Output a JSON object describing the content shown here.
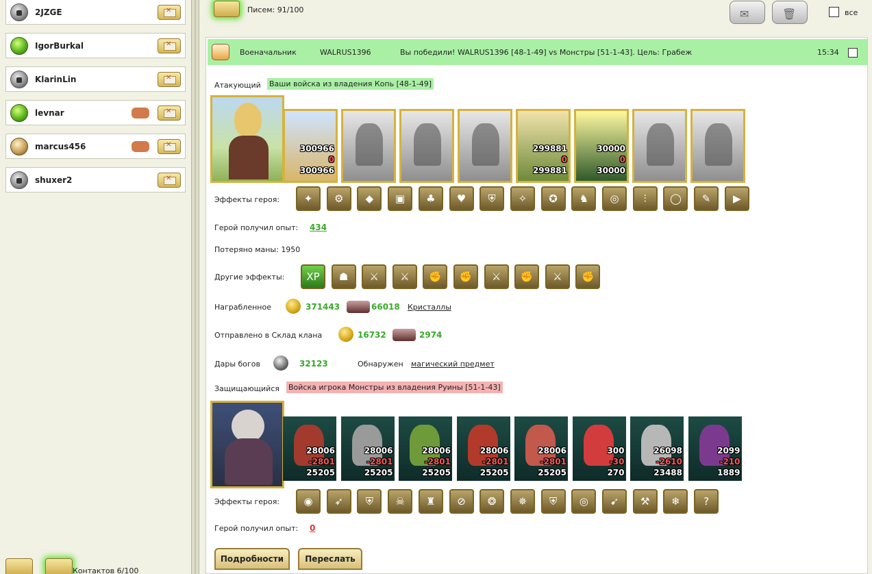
{
  "contacts": [
    {
      "name": "2JZGE",
      "avatar": "lock-icon",
      "has_shake": false
    },
    {
      "name": "IgorBurkal",
      "avatar": "green-gem-icon",
      "has_shake": false
    },
    {
      "name": "KlarinLin",
      "avatar": "lock-icon",
      "has_shake": false
    },
    {
      "name": "levnar",
      "avatar": "green-gem-icon",
      "has_shake": true
    },
    {
      "name": "marcus456",
      "avatar": "tan-gem-icon",
      "has_shake": true
    },
    {
      "name": "shuxer2",
      "avatar": "lock-icon",
      "has_shake": false
    }
  ],
  "contacts_count": "Контактов 6/100",
  "letters_count": "Писем: 91/100",
  "all_label": "все",
  "message": {
    "rank": "Военачальник",
    "player": "WALRUS1396",
    "summary": "Вы победили! WALRUS1396 [48-1-49] vs Монстры [51-1-43]. Цель: Грабеж",
    "time": "15:34"
  },
  "attacker": {
    "label": "Атакующий",
    "desc": "Ваши войска из владения Копь [48-1-49]",
    "units": [
      {
        "style": "col-a",
        "n1": "300966",
        "n2": "0",
        "n3": "300966"
      },
      {
        "style": "gray",
        "n1": "",
        "n2": "",
        "n3": ""
      },
      {
        "style": "gray",
        "n1": "",
        "n2": "",
        "n3": ""
      },
      {
        "style": "gray",
        "n1": "",
        "n2": "",
        "n3": ""
      },
      {
        "style": "col-b",
        "n1": "299881",
        "n2": "0",
        "n3": "299881"
      },
      {
        "style": "col-c",
        "n1": "30000",
        "n2": "0",
        "n3": "30000"
      },
      {
        "style": "gray",
        "n1": "",
        "n2": "",
        "n3": ""
      },
      {
        "style": "gray",
        "n1": "",
        "n2": "",
        "n3": ""
      }
    ],
    "effects_label": "Эффекты героя:",
    "effects": [
      "✦",
      "⚙",
      "◆",
      "▣",
      "♣",
      "♥",
      "⛨",
      "✧",
      "✪",
      "♞",
      "◎",
      "⫶",
      "◯",
      "✎",
      "▶"
    ],
    "exp_label": "Герой получил опыт:",
    "exp": "434",
    "mana_text": "Потеряно маны: 1950",
    "other_label": "Другие эффекты:",
    "other_effects": [
      "XP",
      "☗",
      "⚔",
      "⚔",
      "✊",
      "✊",
      "⚔",
      "✊",
      "⚔",
      "✊"
    ],
    "loot_label": "Награбленное",
    "loot_gold": "371443",
    "loot_ore": "66018",
    "loot_link": "Кристаллы",
    "clan_label": "Отправлено в Склад клана",
    "clan_gold": "16732",
    "clan_ore": "2974",
    "gifts_label": "Дары богов",
    "gifts_value": "32123",
    "found_label": "Обнаружен",
    "found_link": "магический предмет"
  },
  "defender": {
    "label": "Защищающийся",
    "desc": "Войска игрока Монстры из владения Руины [51-1-43]",
    "units": [
      {
        "style": "m1",
        "n1": "28006",
        "n2": "-2801",
        "n3": "25205"
      },
      {
        "style": "m2",
        "n1": "28006",
        "n2": "-2801",
        "n3": "25205"
      },
      {
        "style": "m3",
        "n1": "28006",
        "n2": "-2801",
        "n3": "25205"
      },
      {
        "style": "m4",
        "n1": "28006",
        "n2": "-2801",
        "n3": "25205"
      },
      {
        "style": "m5",
        "n1": "28006",
        "n2": "-2801",
        "n3": "25205"
      },
      {
        "style": "m6",
        "n1": "300",
        "n2": "-30",
        "n3": "270"
      },
      {
        "style": "m7",
        "n1": "26098",
        "n2": "-2610",
        "n3": "23488"
      },
      {
        "style": "m8",
        "n1": "2099",
        "n2": "-210",
        "n3": "1889"
      }
    ],
    "effects_label": "Эффекты героя:",
    "effects": [
      "◉",
      "➶",
      "⛨",
      "☠",
      "♜",
      "⊘",
      "❂",
      "✵",
      "⛨",
      "◎",
      "➹",
      "⚒",
      "❄",
      "?"
    ],
    "exp_label": "Герой получил опыт:",
    "exp": "0"
  },
  "buttons": {
    "details": "Подробности",
    "forward": "Переслать"
  }
}
